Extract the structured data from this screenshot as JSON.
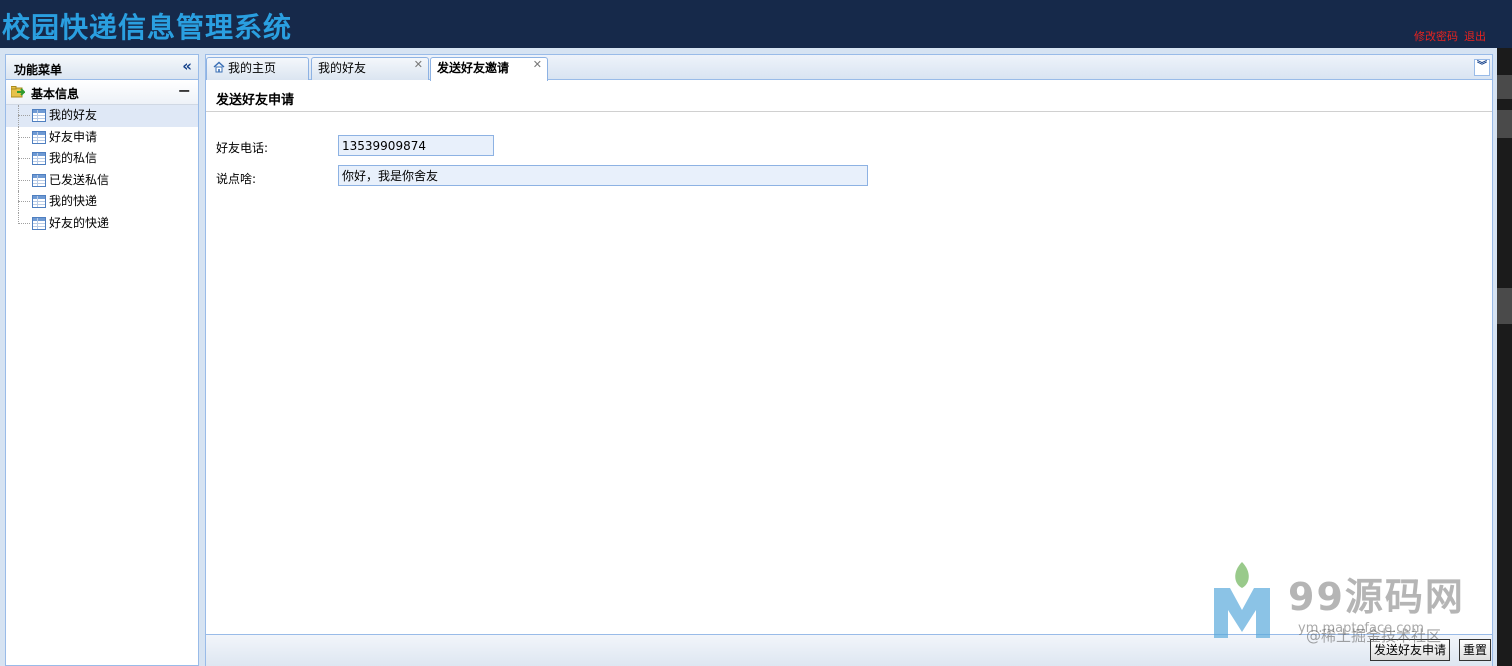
{
  "app": {
    "title": "校园快递信息管理系统",
    "change_password": "修改密码",
    "logout": "退出"
  },
  "sidebar": {
    "title": "功能菜单",
    "group_label": "基本信息",
    "items": [
      {
        "label": "我的好友",
        "selected": true
      },
      {
        "label": "好友申请"
      },
      {
        "label": "我的私信"
      },
      {
        "label": "已发送私信"
      },
      {
        "label": "我的快递"
      },
      {
        "label": "好友的快递"
      }
    ]
  },
  "tabs": [
    {
      "label": "我的主页",
      "icon": "home-icon",
      "closable": false
    },
    {
      "label": "我的好友",
      "closable": true
    },
    {
      "label": "发送好友邀请",
      "closable": true,
      "active": true
    }
  ],
  "form": {
    "title": "发送好友申请",
    "phone_label": "好友电话:",
    "phone_value": "13539909874",
    "message_label": "说点啥:",
    "message_value": "你好，我是你舍友"
  },
  "actions": {
    "submit": "发送好友申请",
    "reset": "重置"
  },
  "watermark": {
    "brand": "99源码网",
    "url": "ym.maptoface.com",
    "credit": "@稀土掘金技术社区"
  },
  "colors": {
    "header_bg": "#16294a",
    "title_color": "#2a9fe0",
    "link_color": "#e8231f",
    "border": "#99bbe8"
  }
}
